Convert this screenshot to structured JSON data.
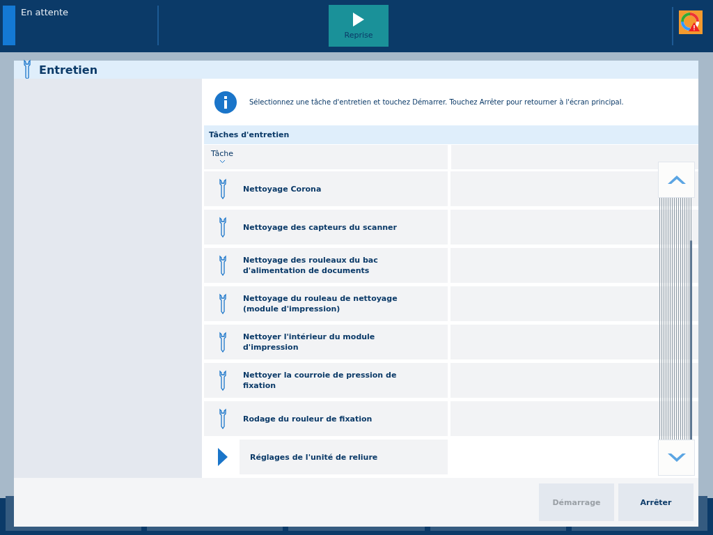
{
  "status": {
    "label": "En attente"
  },
  "resume_button": {
    "label": "Reprise"
  },
  "dialog": {
    "title": "Entretien",
    "info": "Sélectionnez une tâche d'entretien et touchez Démarrer. Touchez Arrêter pour retourner à l'écran principal.",
    "section_title": "Tâches d'entretien",
    "table": {
      "columns": [
        "Tâche"
      ],
      "rows": [
        {
          "label": "Nettoyage Corona",
          "selected": false
        },
        {
          "label": "Nettoyage des capteurs du scanner",
          "selected": false
        },
        {
          "label": "Nettoyage des rouleaux du bac\nd'alimentation de documents",
          "selected": false
        },
        {
          "label": "Nettoyage du rouleau de nettoyage\n(module d'impression)",
          "selected": false
        },
        {
          "label": "Nettoyer l'intérieur du module\nd'impression",
          "selected": false
        },
        {
          "label": "Nettoyer la courroie de pression de\nfixation",
          "selected": false
        },
        {
          "label": "Rodage du rouleur de fixation",
          "selected": false
        },
        {
          "label": "Réglages de l'unité de reliure",
          "selected": true
        }
      ]
    },
    "buttons": [
      {
        "label": "Démarrage",
        "disabled": true
      },
      {
        "label": "Arrêter",
        "disabled": false
      }
    ]
  }
}
